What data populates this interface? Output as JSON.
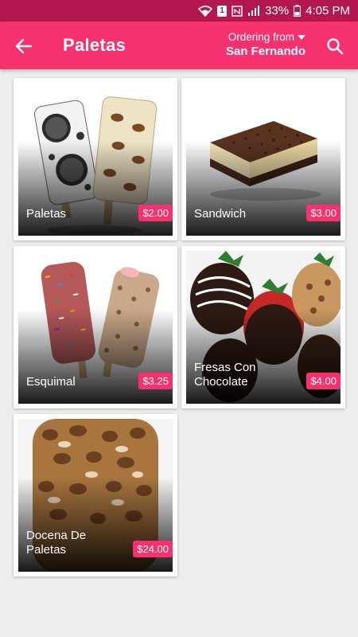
{
  "status": {
    "battery": "33%",
    "time": "4:05 PM",
    "sim": "1"
  },
  "header": {
    "title": "Paletas",
    "ordering_label": "Ordering from",
    "location": "San Fernando"
  },
  "items": [
    {
      "name": "Paletas",
      "price": "$2.00"
    },
    {
      "name": "Sandwich",
      "price": "$3.00"
    },
    {
      "name": "Esquimal",
      "price": "$3.25"
    },
    {
      "name": "Fresas Con Chocolate",
      "price": "$4.00"
    },
    {
      "name": "Docena De Paletas",
      "price": "$24.00"
    }
  ],
  "colors": {
    "primary": "#f5326e",
    "status_bar": "#b3174f",
    "background": "#ededed"
  },
  "icons": [
    "back-arrow-icon",
    "dropdown-arrow-icon",
    "search-icon",
    "wifi-icon",
    "signal-icon",
    "battery-icon"
  ]
}
